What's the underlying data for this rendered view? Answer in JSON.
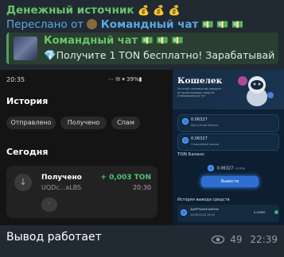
{
  "message": {
    "sender": "Денежный источник",
    "sender_emoji": "💰 💰 💰",
    "forward_prefix": "Переслано от",
    "forward_from": "Командный чат",
    "forward_emoji": "💵 💵 💵",
    "reply_name": "Командный чат",
    "reply_emoji": "💵 💵 💵",
    "reply_text": "💎Получите 1 TON бесплатно! Зарабатывай",
    "caption": "Вывод работает",
    "views": "49",
    "time": "22:39"
  },
  "left_screen": {
    "status_time": "20:35",
    "status_icons": "⋯ ✉ ▾ 39%▮",
    "title": "История",
    "chips": [
      "Отправлено",
      "Получено",
      "Спам"
    ],
    "section": "Сегодня",
    "transaction": {
      "title": "Получено",
      "address": "UQDc...aLBS",
      "amount": "+ 0,003 TON",
      "time": "20:30",
      "more": "·"
    }
  },
  "right_screen": {
    "title": "Кошелек",
    "subtitle": "На этой странице вы увидите историю вывода средств отображаемую тут",
    "box1_value": "0.06327",
    "box1_label": "Доступный баланс",
    "box2_value": "0.06327",
    "box2_label": "Ожидаемый доход",
    "ton_balance_label": "TON Баланс",
    "balance": "0.06327",
    "balance_unit": "≈0.00$",
    "withdraw_label": "Вывести",
    "history_title": "История вывода средств",
    "history_address": "4qSPT9xNcE·KoE5hn",
    "history_date": "29/06/2025 16:30",
    "history_amount": "0.00300"
  },
  "colors": {
    "sender": "#6ac46a",
    "forward": "#5aa9e6",
    "accent_green": "#4fc37a",
    "wallet_button": "#2f6fd1"
  }
}
